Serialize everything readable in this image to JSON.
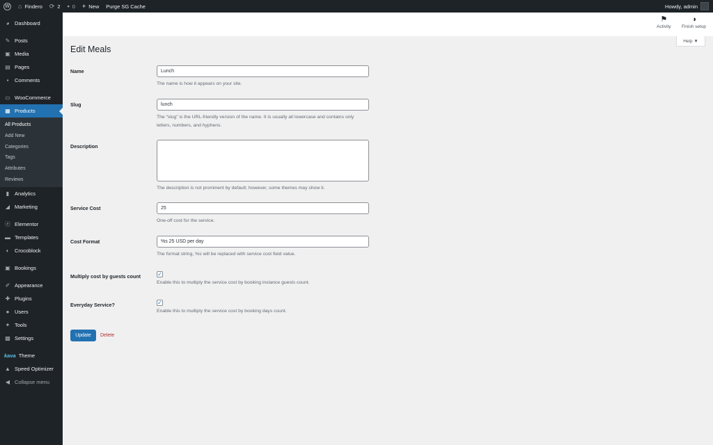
{
  "adminbar": {
    "site_name": "Findero",
    "updates_count": "2",
    "comments_count": "0",
    "new_label": "New",
    "purge_label": "Purge SG Cache",
    "howdy": "Howdy, admin"
  },
  "sidebar": {
    "items": {
      "dashboard": "Dashboard",
      "posts": "Posts",
      "media": "Media",
      "pages": "Pages",
      "comments": "Comments",
      "woocommerce": "WooCommerce",
      "products": "Products",
      "analytics": "Analytics",
      "marketing": "Marketing",
      "elementor": "Elementor",
      "templates": "Templates",
      "crocoblock": "Crocoblock",
      "bookings": "Bookings",
      "appearance": "Appearance",
      "plugins": "Plugins",
      "users": "Users",
      "tools": "Tools",
      "settings": "Settings",
      "kava_brand": "kava",
      "theme": "Theme",
      "speed_optimizer": "Speed Optimizer",
      "collapse": "Collapse menu"
    },
    "products_submenu": [
      "All Products",
      "Add New",
      "Categories",
      "Tags",
      "Attributes",
      "Reviews"
    ]
  },
  "header": {
    "activity_label": "Activity",
    "finish_setup_label": "Finish setup",
    "help_label": "Help ▼"
  },
  "page": {
    "title": "Edit Meals"
  },
  "form": {
    "name": {
      "label": "Name",
      "value": "Lunch",
      "help": "The name is how it appears on your site."
    },
    "slug": {
      "label": "Slug",
      "value": "lunch",
      "help": "The “slug” is the URL-friendly version of the name. It is usually all lowercase and contains only letters, numbers, and hyphens."
    },
    "description": {
      "label": "Description",
      "value": "",
      "help": "The description is not prominent by default; however, some themes may show it."
    },
    "service_cost": {
      "label": "Service Cost",
      "value": "25",
      "help": "One-off cost for the service."
    },
    "cost_format": {
      "label": "Cost Format",
      "value": "%s 25 USD per day",
      "help": "The format string, %s will be replaced with service cost field value."
    },
    "multiply_guests": {
      "label": "Multiply cost by guests count",
      "checked": true,
      "help": "Enable this to multiply the service cost by booking instance guests count."
    },
    "everyday": {
      "label": "Everyday Service?",
      "checked": true,
      "help": "Enable this to multiply the service cost by booking days count."
    },
    "update_label": "Update",
    "delete_label": "Delete"
  },
  "colors": {
    "admin_dark": "#1d2327",
    "accent": "#2271b1",
    "delete_red": "#b32d2e"
  }
}
